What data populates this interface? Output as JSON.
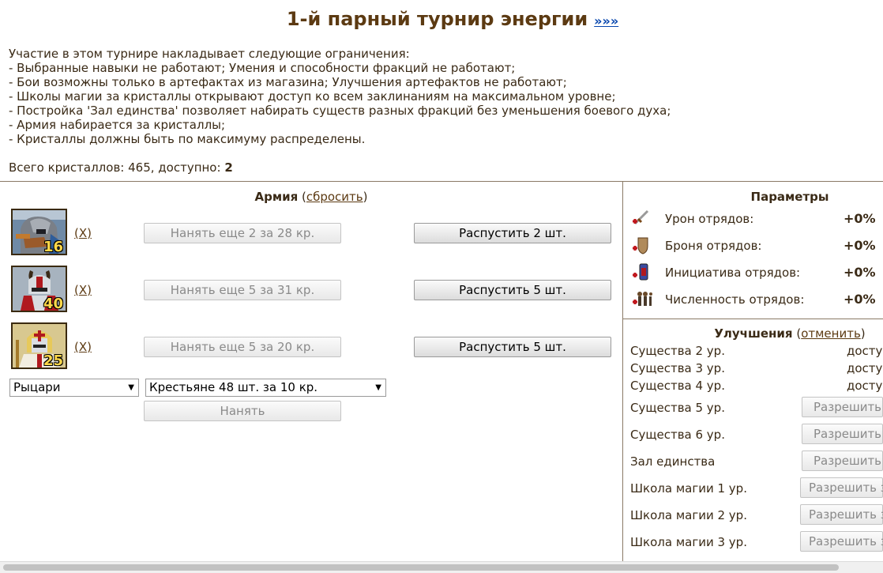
{
  "header": {
    "title": "1-й парный турнир энергии",
    "link": "»»»"
  },
  "intro": {
    "lines": [
      "Участие в этом турнире накладывает следующие ограничения:",
      "- Выбранные навыки не работают; Умения и способности фракций не работают;",
      "- Бои возможны только в артефактах из магазина; Улучшения артефактов не работают;",
      "- Школы магии за кристаллы открывают доступ ко всем заклинаниям на максимальном уровне;",
      "- Постройка 'Зал единства' позволяет набирать существ разных фракций без уменьшения боевого духа;",
      "- Армия набирается за кристаллы;",
      "- Кристаллы должны быть по максимуму распределены."
    ],
    "totals_label": "Всего кристаллов: 465, доступно: ",
    "available": "2"
  },
  "army": {
    "title": "Армия",
    "reset_label": "сбросить",
    "units": [
      {
        "count": "16",
        "remove": "X",
        "hire_label": "Нанять еще 2 за 28 кр.",
        "dismiss_label": "Распустить 2 шт."
      },
      {
        "count": "40",
        "remove": "X",
        "hire_label": "Нанять еще 5 за 31 кр.",
        "dismiss_label": "Распустить 5 шт."
      },
      {
        "count": "25",
        "remove": "X",
        "hire_label": "Нанять еще 5 за 20 кр.",
        "dismiss_label": "Распустить 5 шт."
      }
    ],
    "faction_select": "Рыцари",
    "creature_select": "Крестьяне 48 шт. за 10 кр.",
    "hire_button": "Нанять"
  },
  "params": {
    "title": "Параметры",
    "rows": [
      {
        "icon": "sword-damage-icon",
        "label": "Урон отрядов:",
        "value": "+0%"
      },
      {
        "icon": "shield-armor-icon",
        "label": "Броня отрядов:",
        "value": "+0%"
      },
      {
        "icon": "hourglass-initiative-icon",
        "label": "Инициатива отрядов:",
        "value": "+0%"
      },
      {
        "icon": "troops-count-icon",
        "label": "Численность отрядов:",
        "value": "+0%"
      }
    ]
  },
  "upgrades": {
    "title": "Улучшения",
    "cancel_label": "отменить",
    "rows": [
      {
        "label": "Существа 2 ур.",
        "status": "досту"
      },
      {
        "label": "Существа 3 ур.",
        "status": "досту"
      },
      {
        "label": "Существа 4 ур.",
        "status": "досту"
      },
      {
        "label": "Существа 5 ур.",
        "button": "Разрешить"
      },
      {
        "label": "Существа 6 ур.",
        "button": "Разрешить"
      },
      {
        "label": "Зал единства",
        "button": "Разрешить"
      },
      {
        "label": "Школа магии 1 ур.",
        "button": "Разрешить з"
      },
      {
        "label": "Школа магии 2 ур.",
        "button": "Разрешить з"
      },
      {
        "label": "Школа магии 3 ур.",
        "button": "Разрешить з"
      }
    ]
  },
  "colors": {
    "text": "#3a2a16",
    "heading": "#5c3a12",
    "link_blue": "#0645ad",
    "divider": "#8a7a66"
  }
}
